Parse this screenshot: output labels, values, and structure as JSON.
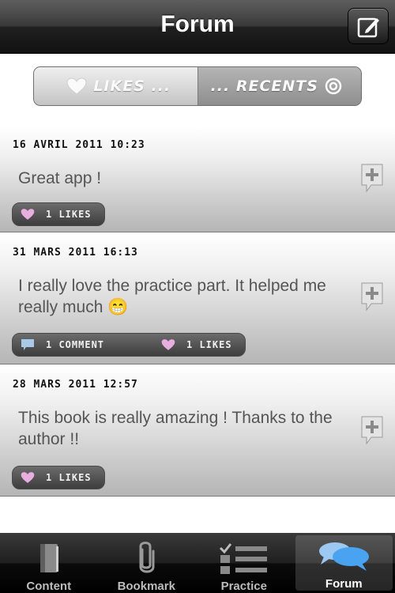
{
  "header": {
    "title": "Forum"
  },
  "segment": {
    "likes_label": "LIKES ...",
    "recents_label": "... RECENTS"
  },
  "posts": [
    {
      "date": "16 AVRIL 2011 10:23",
      "text": "Great app !",
      "likes": "1 LIKES"
    },
    {
      "date": "31 MARS 2011 16:13",
      "text": "I really love the practice part. It helped me really much 😁",
      "comments": "1 COMMENT",
      "likes": "1 LIKES"
    },
    {
      "date": "28 MARS 2011 12:57",
      "text": "This book is really amazing ! Thanks to the author !!",
      "likes": "1 LIKES"
    }
  ],
  "tabs": [
    {
      "label": "Content",
      "icon": "book-icon"
    },
    {
      "label": "Bookmark",
      "icon": "paperclip-icon"
    },
    {
      "label": "Practice",
      "icon": "checklist-icon"
    },
    {
      "label": "Forum",
      "icon": "chat-bubbles-icon",
      "active": true
    }
  ],
  "colors": {
    "accent_blue": "#4aa3f0",
    "heart_pink": "#e8aee0"
  }
}
